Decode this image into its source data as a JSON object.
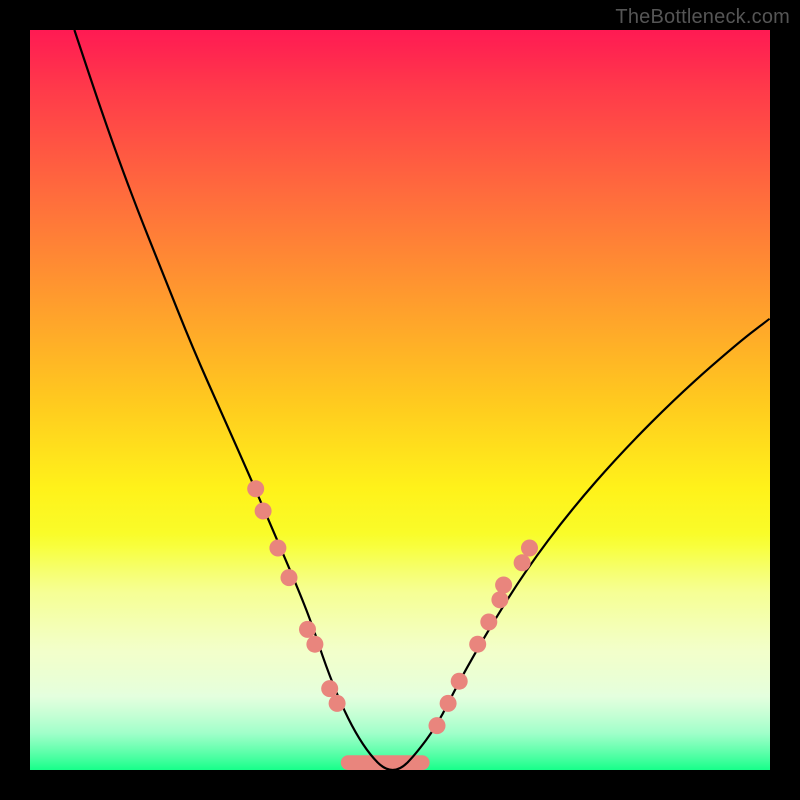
{
  "watermark": "TheBottleneck.com",
  "chart_data": {
    "type": "line",
    "title": "",
    "xlabel": "",
    "ylabel": "",
    "xlim": [
      0,
      100
    ],
    "ylim": [
      0,
      100
    ],
    "background_gradient": {
      "orientation": "vertical",
      "stops": [
        {
          "pos": 0,
          "color": "#ff1a53"
        },
        {
          "pos": 22,
          "color": "#ff6b3d"
        },
        {
          "pos": 50,
          "color": "#ffc91f"
        },
        {
          "pos": 70,
          "color": "#f7ff2e"
        },
        {
          "pos": 90,
          "color": "#d9ffd0"
        },
        {
          "pos": 100,
          "color": "#17ff8a"
        }
      ]
    },
    "series": [
      {
        "name": "bottleneck-curve",
        "stroke": "#000000",
        "x": [
          6,
          10,
          14,
          18,
          22,
          26,
          30,
          33,
          36,
          38,
          40,
          42,
          44,
          46,
          48,
          50,
          52,
          55,
          58,
          62,
          67,
          73,
          80,
          88,
          96,
          100
        ],
        "y": [
          100,
          88,
          77,
          67,
          57,
          48,
          39,
          32,
          25,
          20,
          14,
          9,
          5,
          2,
          0,
          0,
          2,
          6,
          12,
          19,
          27,
          35,
          43,
          51,
          58,
          61
        ]
      }
    ],
    "markers": [
      {
        "name": "dots-left",
        "color": "#e9857d",
        "points": [
          {
            "x": 30.5,
            "y": 38
          },
          {
            "x": 31.5,
            "y": 35
          },
          {
            "x": 33.5,
            "y": 30
          },
          {
            "x": 35.0,
            "y": 26
          },
          {
            "x": 37.5,
            "y": 19
          },
          {
            "x": 38.5,
            "y": 17
          },
          {
            "x": 40.5,
            "y": 11
          },
          {
            "x": 41.5,
            "y": 9
          }
        ]
      },
      {
        "name": "dots-right",
        "color": "#e9857d",
        "points": [
          {
            "x": 55.0,
            "y": 6
          },
          {
            "x": 56.5,
            "y": 9
          },
          {
            "x": 58.0,
            "y": 12
          },
          {
            "x": 60.5,
            "y": 17
          },
          {
            "x": 62.0,
            "y": 20
          },
          {
            "x": 63.5,
            "y": 23
          },
          {
            "x": 64.0,
            "y": 25
          },
          {
            "x": 66.5,
            "y": 28
          },
          {
            "x": 67.5,
            "y": 30
          }
        ]
      }
    ],
    "flat_band": {
      "color": "#e9857d",
      "y": 0,
      "x_start": 42,
      "x_end": 54,
      "thickness_pct": 2.0
    }
  }
}
